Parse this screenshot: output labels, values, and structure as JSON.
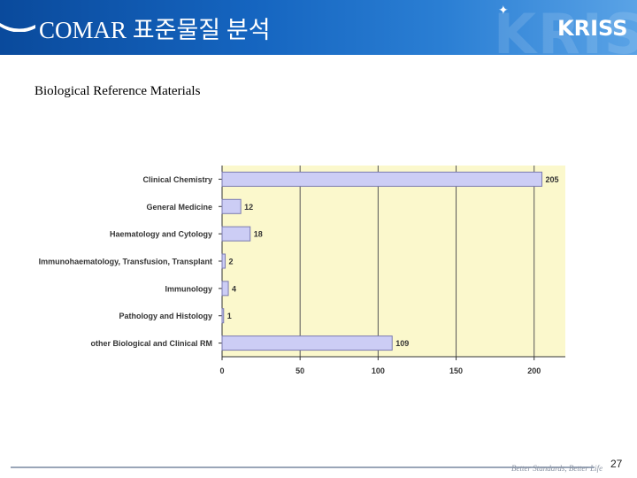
{
  "header": {
    "title": "COMAR 표준물질 분석",
    "logo_text": "KRISS",
    "ghost_text": "KRISS",
    "colors": {
      "band_start": "#0a4a9c",
      "band_end": "#5aa3e6"
    }
  },
  "subtitle": "Biological Reference Materials",
  "chart_data": {
    "type": "bar",
    "orientation": "horizontal",
    "categories": [
      "Clinical Chemistry",
      "General Medicine",
      "Haematology and Cytology",
      "Immunohaematology, Transfusion, Transplant",
      "Immunology",
      "Pathology and Histology",
      "other Biological and Clinical RM"
    ],
    "values": [
      205,
      12,
      18,
      2,
      4,
      1,
      109
    ],
    "data_labels": [
      "205",
      "12",
      "18",
      "2",
      "4",
      "1",
      "109"
    ],
    "xlim": [
      0,
      220
    ],
    "xticks": [
      0,
      50,
      100,
      150,
      200
    ],
    "xtick_labels": [
      "0",
      "50",
      "100",
      "150",
      "200"
    ],
    "grid": "vertical",
    "title": "",
    "xlabel": "",
    "ylabel": "",
    "colors": {
      "bar_fill": "#cccdf5",
      "bar_stroke": "#7b7bb0",
      "plot_bg": "#fbf8cc",
      "grid": "#555555"
    }
  },
  "footer": {
    "tagline": "Better Standards, Better Life",
    "page_number": "27"
  }
}
